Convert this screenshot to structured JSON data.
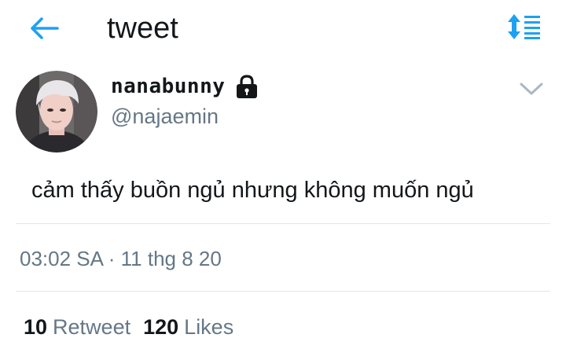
{
  "header": {
    "title": "tweet",
    "back_icon": "arrow-left-icon",
    "sort_icon": "sort-arrows-icon",
    "accent_color": "#1da1f2"
  },
  "tweet": {
    "author": {
      "display_name": "nanabunny",
      "handle": "@najaemin",
      "protected": true,
      "lock_icon": "lock-icon",
      "avatar_icon": "avatar-photo"
    },
    "menu_icon": "chevron-down-icon",
    "text": "cảm thấy buồn ngủ nhưng không muốn ngủ",
    "timestamp": "03:02 SA · 11 thg 8 20",
    "stats": {
      "retweets_count": "10",
      "retweets_label": "Retweet",
      "likes_count": "120",
      "likes_label": "Likes"
    }
  },
  "colors": {
    "text_primary": "#14171a",
    "text_secondary": "#657786",
    "divider": "#e1e8ed"
  }
}
